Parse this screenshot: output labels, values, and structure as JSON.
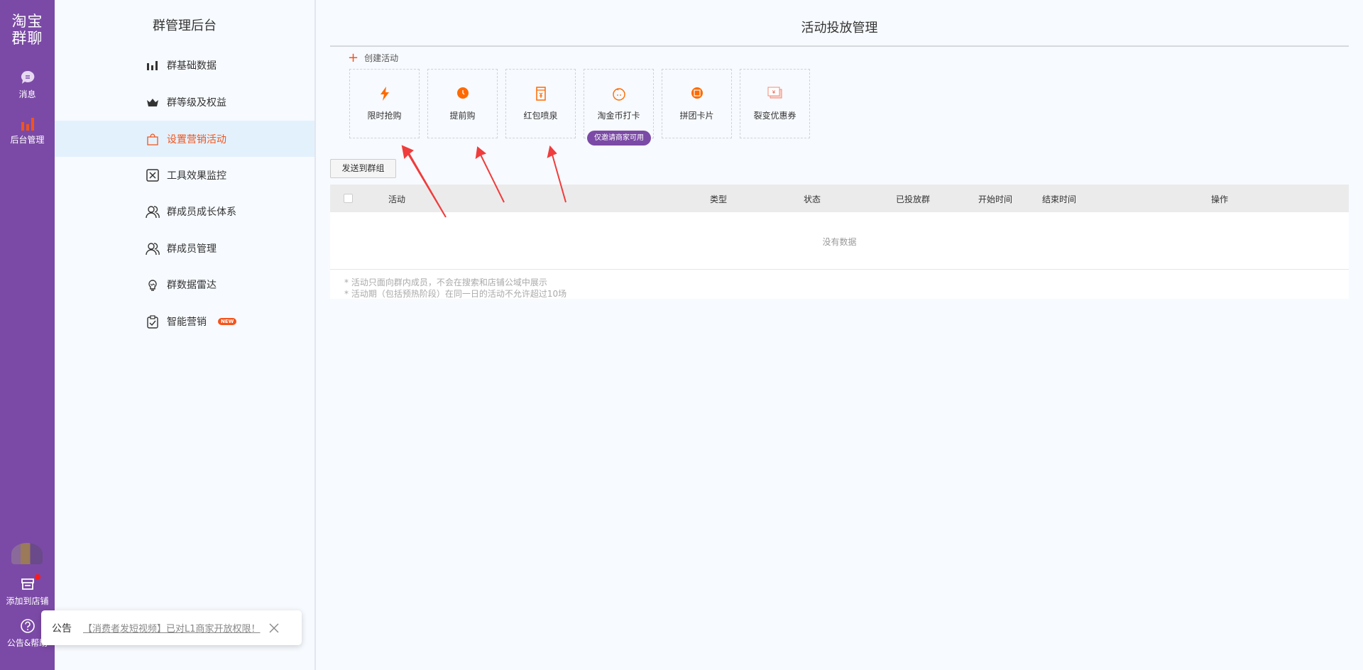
{
  "rail": {
    "logo": [
      "淘宝",
      "群聊"
    ],
    "items": [
      {
        "label": "消息",
        "icon": "chat-icon"
      },
      {
        "label": "后台管理",
        "icon": "bar-chart-icon",
        "active": true
      }
    ],
    "bottom": [
      {
        "label": "添加到店铺",
        "icon": "store-icon",
        "dot": true
      },
      {
        "label": "公告&帮助",
        "icon": "help-icon"
      }
    ]
  },
  "panel": {
    "title": "群管理后台",
    "menu": [
      {
        "label": "群基础数据",
        "icon": "bar-chart-icon"
      },
      {
        "label": "群等级及权益",
        "icon": "crown-icon"
      },
      {
        "label": "设置营销活动",
        "icon": "shopping-bag-icon",
        "active": true
      },
      {
        "label": "工具效果监控",
        "icon": "monitor-icon"
      },
      {
        "label": "群成员成长体系",
        "icon": "users-icon"
      },
      {
        "label": "群成员管理",
        "icon": "users-icon"
      },
      {
        "label": "群数据雷达",
        "icon": "lightbulb-icon"
      },
      {
        "label": "智能营销",
        "icon": "clipboard-check-icon",
        "badge": "NEW"
      }
    ]
  },
  "main": {
    "title": "活动投放管理",
    "create_label": "创建活动",
    "cards": [
      {
        "label": "限时抢购",
        "icon": "lightning-icon"
      },
      {
        "label": "提前购",
        "icon": "clock-icon"
      },
      {
        "label": "红包喷泉",
        "icon": "red-packet-icon"
      },
      {
        "label": "淘金币打卡",
        "icon": "coin-face-icon",
        "badge": "仅邀请商家可用"
      },
      {
        "label": "拼团卡片",
        "icon": "group-buy-icon"
      },
      {
        "label": "裂变优惠券",
        "icon": "coupon-icon"
      }
    ],
    "send_button": "发送到群组",
    "table": {
      "columns": [
        "活动",
        "类型",
        "状态",
        "已投放群",
        "开始时间",
        "结束时间",
        "操作"
      ],
      "empty": "没有数据"
    },
    "notes": [
      "* 活动只面向群内成员，不会在搜索和店铺公域中展示",
      "* 活动期（包括预热阶段）在同一日的活动不允许超过10场"
    ]
  },
  "notice": {
    "label": "公告",
    "link": "【消费者发短视频】已对L1商家开放权限！"
  },
  "colors": {
    "rail": "#7b4aa6",
    "accent": "#f2541b",
    "active_bg": "#e3f1fd",
    "arrow": "#f03c3c"
  }
}
